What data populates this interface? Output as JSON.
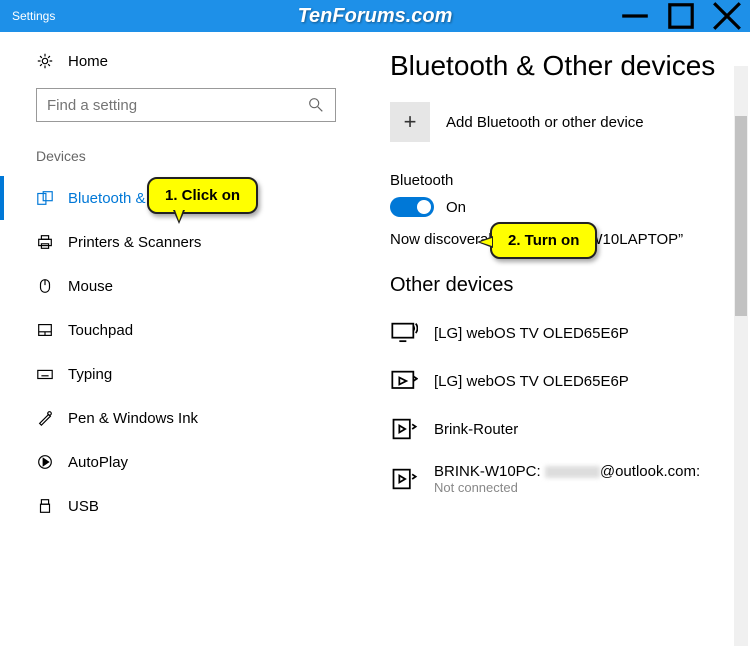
{
  "titlebar": {
    "title": "Settings",
    "watermark": "TenForums.com"
  },
  "sidebar": {
    "home": "Home",
    "search_placeholder": "Find a setting",
    "section": "Devices",
    "items": [
      {
        "label": "Bluetooth & Other devices",
        "active": true
      },
      {
        "label": "Printers & Scanners"
      },
      {
        "label": "Mouse"
      },
      {
        "label": "Touchpad"
      },
      {
        "label": "Typing"
      },
      {
        "label": "Pen & Windows Ink"
      },
      {
        "label": "AutoPlay"
      },
      {
        "label": "USB"
      }
    ]
  },
  "main": {
    "title": "Bluetooth & Other devices",
    "add_label": "Add Bluetooth or other device",
    "bt_label": "Bluetooth",
    "bt_state": "On",
    "discover": "Now discoverable as “BRINK-W10LAPTOP”",
    "other_title": "Other devices",
    "devices": [
      {
        "name": "[LG] webOS TV OLED65E6P"
      },
      {
        "name": "[LG] webOS TV OLED65E6P"
      },
      {
        "name": "Brink-Router"
      },
      {
        "name": "BRINK-W10PC:",
        "tail": "@outlook.com:",
        "status": "Not connected"
      }
    ]
  },
  "callouts": {
    "c1": "1. Click on",
    "c2": "2. Turn on"
  }
}
